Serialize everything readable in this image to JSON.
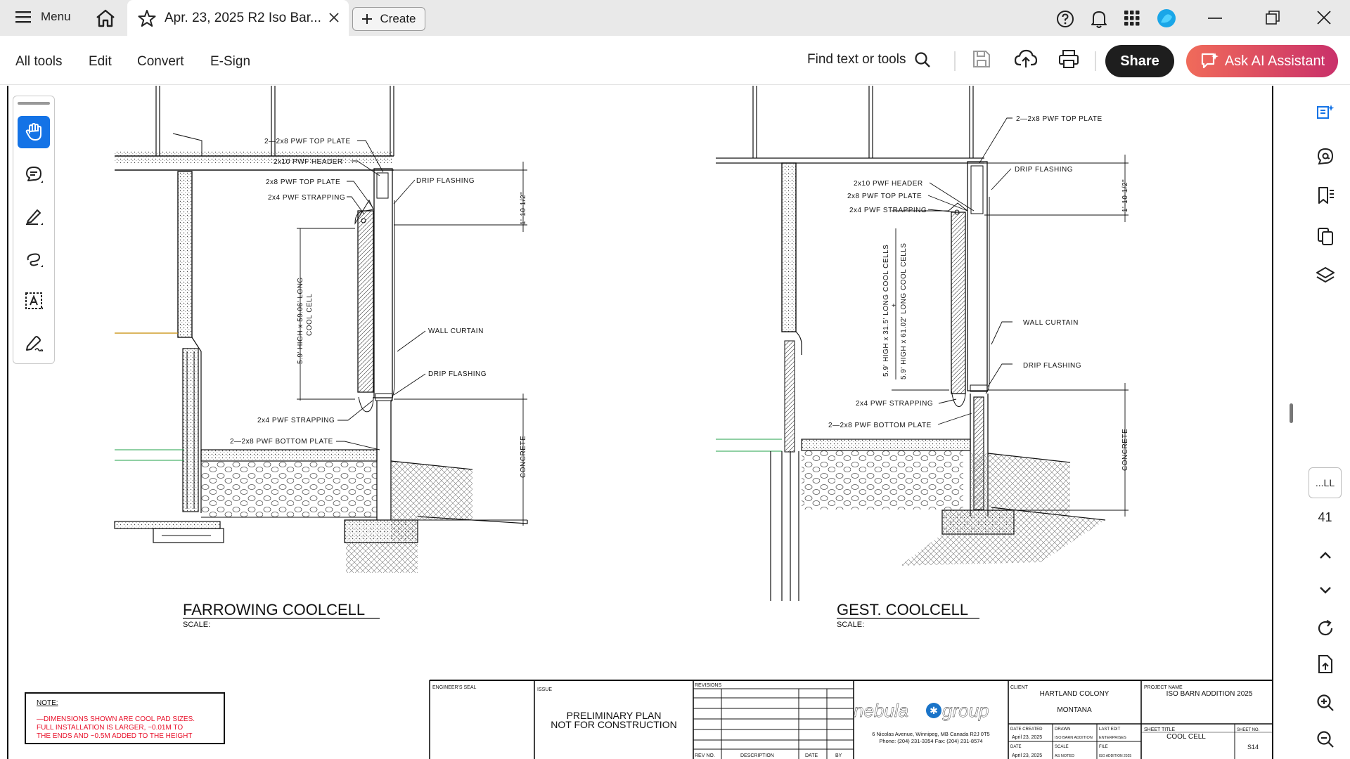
{
  "tabbar": {
    "menu_label": "Menu",
    "tab_title": "Apr. 23, 2025 R2 Iso Bar...",
    "create_label": "Create"
  },
  "toolbar": {
    "all_tools": "All tools",
    "edit": "Edit",
    "convert": "Convert",
    "esign": "E-Sign",
    "find": "Find text or tools",
    "share": "Share",
    "ai": "Ask AI Assistant"
  },
  "rail": {
    "page_label": "...LL",
    "page_number": "41"
  },
  "drawing": {
    "left": {
      "title": "FARROWING COOLCELL",
      "scale": "SCALE:",
      "labels": {
        "top_plate_2": "2—2x8  PWF  TOP  PLATE",
        "header": "2x10  PWF  HEADER",
        "top_plate": "2x8  PWF  TOP  PLATE",
        "strapping_top": "2x4  PWF  STRAPPING",
        "drip_top": "DRIP  FLASHING",
        "dim_top": "1'-10 1/2\"",
        "cell_dim1": "5.9' HIGH x 59.06' LONG",
        "cell_dim2": "COOL CELL",
        "wall_curtain": "WALL  CURTAIN",
        "drip_bottom": "DRIP  FLASHING",
        "strapping_bottom": "2x4  PWF  STRAPPING",
        "bottom_plate": "2—2x8  PWF  BOTTOM  PLATE",
        "concrete": "CONCRETE"
      }
    },
    "right": {
      "title": "GEST. COOLCELL",
      "scale": "SCALE:",
      "labels": {
        "top_plate_2": "2—2x8  PWF  TOP  PLATE",
        "drip_top": "DRIP  FLASHING",
        "header": "2x10  PWF  HEADER",
        "top_plate": "2x8  PWF  TOP  PLATE",
        "strapping_top": "2x4  PWF  STRAPPING",
        "dim_top": "1'-10 1/2\"",
        "cell_dim1": "5.9' HIGH x 31.5' LONG COOL CELLS",
        "plus": "+",
        "cell_dim2": "5.9' HIGH x 61.02' LONG COOL CELLS",
        "wall_curtain": "WALL  CURTAIN",
        "drip_bottom": "DRIP  FLASHING",
        "strapping_bottom": "2x4  PWF  STRAPPING",
        "bottom_plate": "2—2x8  PWF  BOTTOM  PLATE",
        "concrete": "CONCRETE"
      }
    },
    "note": {
      "heading": "NOTE:",
      "line1": "—DIMENSIONS  SHOWN  ARE  COOL  PAD  SIZES.",
      "line2": "FULL  INSTALLATION  IS  LARGER,  ~0.01M  TO",
      "line3": "THE  ENDS  AND  ~0.5M  ADDED  TO  THE  HEIGHT"
    },
    "titleblock": {
      "engineer_seal": "ENGINEER'S SEAL",
      "issue": "ISSUE",
      "issue_line1": "PRELIMINARY PLAN",
      "issue_line2": "NOT FOR CONSTRUCTION",
      "revisions": "REVISIONS",
      "rev_no": "REV NO.",
      "description": "DESCRIPTION",
      "date": "DATE",
      "by": "BY",
      "logo_left": "nebula",
      "logo_right": "group",
      "address": "6 Nicolas Avenue, Winnipeg, MB Canada R2J 0T5",
      "phone": "Phone: (204) 231-3354     Fax: (204) 231-8574",
      "client_label": "CLIENT",
      "client_1": "HARTLAND COLONY",
      "client_2": "MONTANA",
      "date_created_label": "DATE CREATED",
      "date_created": "April 23, 2025",
      "drawn_label": "DRAWN",
      "drawn": "ISO BARN ADDITION",
      "last_edit_label": "LAST EDIT",
      "last_edit": "ENTERPRISES",
      "date_label": "DATE",
      "date_value": "April 23, 2025",
      "scale_label": "SCALE",
      "scale_value": "AS NOTED",
      "file_label": "FILE",
      "file_value": "ISO ADDITION 2025",
      "project_label": "PROJECT NAME",
      "project": "ISO BARN ADDITION 2025",
      "sheet_title_label": "SHEET TITLE",
      "sheet_title": "COOL CELL",
      "sheet_no_label": "SHEET NO.",
      "sheet_no": "S14"
    }
  },
  "colors": {
    "accent": "#1473e6",
    "share_bg": "#1e1e1e",
    "ai_gradient_start": "#f06b5a",
    "ai_gradient_end": "#c9306a",
    "note_red": "#e8102a"
  }
}
